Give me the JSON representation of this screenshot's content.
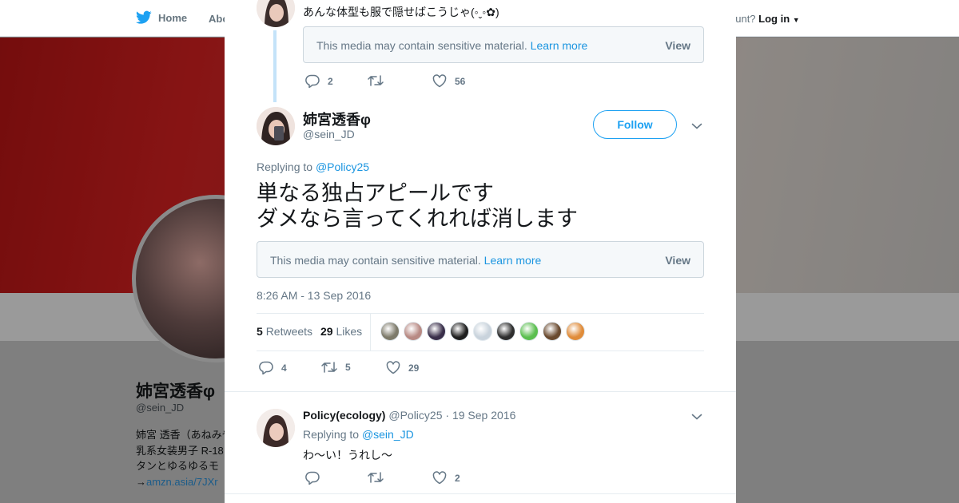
{
  "background": {
    "nav": {
      "home_label": "Home",
      "about_label": "Abo",
      "account_prompt": "ccount?",
      "login_label": "Log in"
    },
    "profile": {
      "name": "姉宮透香φ",
      "handle": "@sein_JD",
      "bio_lines": [
        "姉宮 透香（あねみや",
        "乳系女装男子 R-18",
        "タンとゆるゆるモ"
      ],
      "bio_link_prefix": "→",
      "bio_link": "amzn.asia/7JXr"
    }
  },
  "modal": {
    "parent_tweet": {
      "text": "あんな体型も服で隠せばこうじゃ(◦ˬ◦✿)",
      "media_notice": "This media may contain sensitive material.",
      "learn_more": "Learn more",
      "view_label": "View",
      "replies": "2",
      "retweets": "",
      "likes": "56"
    },
    "main_tweet": {
      "author_name": "姉宮透香φ",
      "author_handle": "@sein_JD",
      "follow_label": "Follow",
      "replying_prefix": "Replying to",
      "replying_to": "@Policy25",
      "text_line1": "単なる独占アピールです",
      "text_line2": "ダメなら言ってくれれば消します",
      "media_notice": "This media may contain sensitive material.",
      "learn_more": "Learn more",
      "view_label": "View",
      "timestamp": "8:26 AM - 13 Sep 2016",
      "retweet_count": "5",
      "retweet_label": "Retweets",
      "like_count": "29",
      "like_label": "Likes",
      "action_replies": "4",
      "action_retweets": "5",
      "action_likes": "29",
      "likers": [
        {
          "icon": "liker-avatar-1",
          "color": "#7d7a6a"
        },
        {
          "icon": "liker-avatar-2",
          "color": "#b88a84"
        },
        {
          "icon": "liker-avatar-3",
          "color": "#3a2f4a"
        },
        {
          "icon": "liker-avatar-4",
          "color": "#1f1f1f"
        },
        {
          "icon": "liker-avatar-5",
          "color": "#c9d3dc"
        },
        {
          "icon": "liker-avatar-6",
          "color": "#2e2e2e"
        },
        {
          "icon": "liker-avatar-7",
          "color": "#5bbf4f"
        },
        {
          "icon": "liker-avatar-8",
          "color": "#6a4a2f"
        },
        {
          "icon": "liker-avatar-9",
          "color": "#e08c3a"
        }
      ]
    },
    "reply_tweet": {
      "author_name": "Policy(ecology)",
      "author_handle": "@Policy25",
      "date": "· 19 Sep 2016",
      "replying_prefix": "Replying to",
      "replying_to": "@sein_JD",
      "text": "わ～い！うれし～",
      "replies": "",
      "retweets": "",
      "likes": "2"
    }
  },
  "colors": {
    "accent": "#1da1f2",
    "link": "#1b95e0",
    "like": "#657786"
  }
}
